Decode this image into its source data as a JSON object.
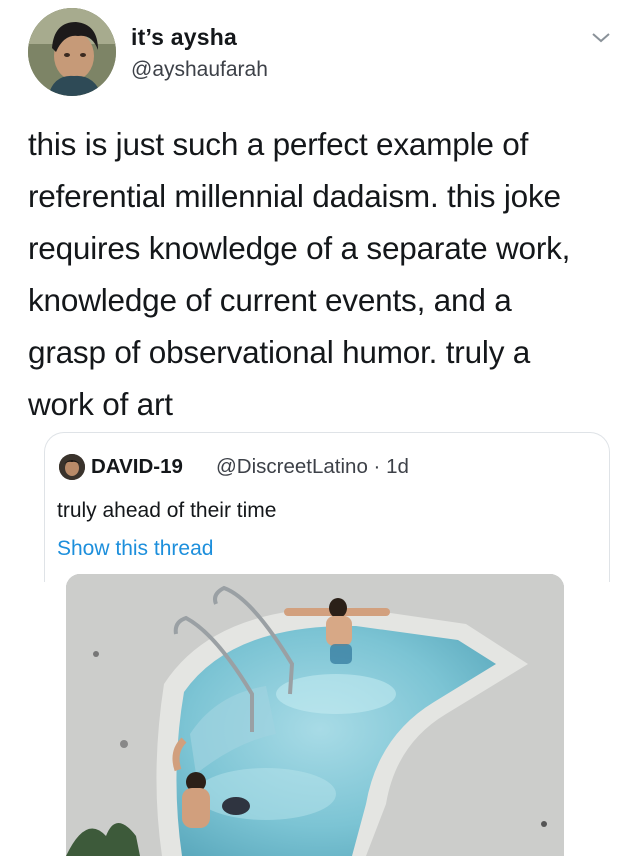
{
  "tweet": {
    "display_name": "it’s aysha",
    "handle": "@ayshaufarah",
    "lines": [
      "this is just such a perfect example of",
      "referential millennial dadaism. this joke",
      "requires knowledge of a separate work,",
      "knowledge of current events, and a",
      "grasp of observational humor. truly a",
      "work of art"
    ],
    "menu_icon": "chevron-down-icon"
  },
  "quote": {
    "name": "DAVID-19",
    "handle_time": "@DiscreetLatino · 1d",
    "text": "truly ahead of their time",
    "show_thread": "Show this thread",
    "link_color": "#1d8fdc",
    "media": "photo of a hot tub / jacuzzi with people in it, seen from above"
  },
  "colors": {
    "text": "#14171a",
    "secondary": "#3d4148",
    "border": "#dfe3e7",
    "water": "#7cc4d4"
  }
}
